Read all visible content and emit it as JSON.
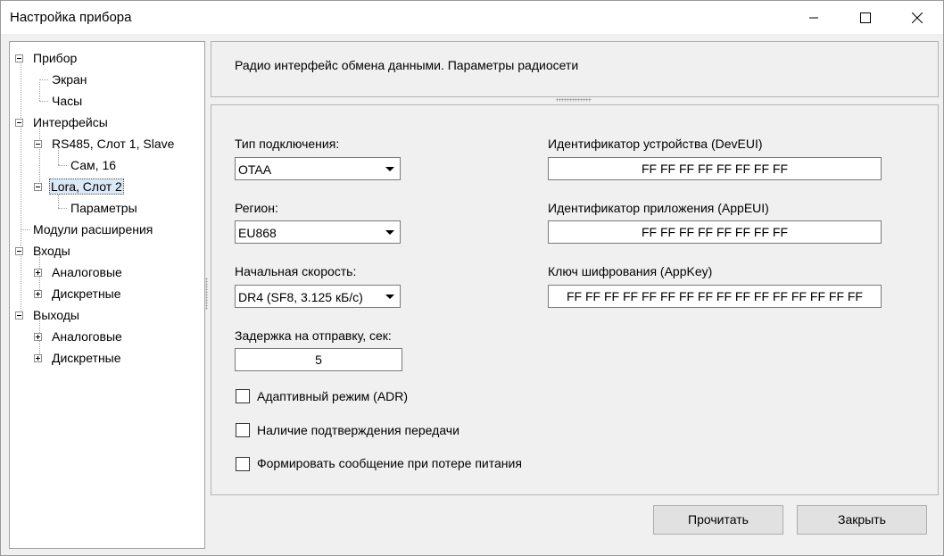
{
  "window": {
    "title": "Настройка прибора",
    "controls": {
      "minimize": "minimize-icon",
      "maximize": "maximize-icon",
      "close": "close-icon"
    }
  },
  "tree": {
    "items": [
      {
        "label": "Прибор",
        "expanded": true
      },
      {
        "label": "Экран"
      },
      {
        "label": "Часы"
      },
      {
        "label": "Интерфейсы",
        "expanded": true
      },
      {
        "label": "RS485, Слот 1, Slave",
        "expanded": true
      },
      {
        "label": "Сам, 16"
      },
      {
        "label": "Lora, Слот 2",
        "expanded": true,
        "selected": true
      },
      {
        "label": "Параметры"
      },
      {
        "label": "Модули расширения"
      },
      {
        "label": "Входы",
        "expanded": true
      },
      {
        "label": "Аналоговые",
        "expanded": false
      },
      {
        "label": "Дискретные",
        "expanded": false
      },
      {
        "label": "Выходы",
        "expanded": true
      },
      {
        "label": "Аналоговые",
        "expanded": false
      },
      {
        "label": "Дискретные",
        "expanded": false
      }
    ]
  },
  "info": {
    "text": "Радио интерфейс обмена данными. Параметры радиосети"
  },
  "settings": {
    "connection_type": {
      "label": "Тип подключения:",
      "value": "OTAA"
    },
    "region": {
      "label": "Регион:",
      "value": "EU868"
    },
    "initial_speed": {
      "label": "Начальная скорость:",
      "value": "DR4 (SF8, 3.125 кБ/с)"
    },
    "send_delay": {
      "label": "Задержка на отправку, сек:",
      "value": "5"
    },
    "dev_eui": {
      "label": "Идентификатор устройства (DevEUI)",
      "value": "FF FF FF FF FF FF FF FF"
    },
    "app_eui": {
      "label": "Идентификатор приложения (AppEUI)",
      "value": "FF FF FF FF FF FF FF FF"
    },
    "app_key": {
      "label": "Ключ шифрования (AppKey)",
      "value": "FF FF FF FF FF FF FF FF FF FF FF FF FF FF FF FF"
    },
    "checkboxes": [
      {
        "label": "Адаптивный режим (ADR)",
        "checked": false
      },
      {
        "label": "Наличие подтверждения передачи",
        "checked": false
      },
      {
        "label": "Формировать сообщение при потере питания",
        "checked": false
      }
    ]
  },
  "buttons": {
    "read": "Прочитать",
    "close": "Закрыть"
  }
}
